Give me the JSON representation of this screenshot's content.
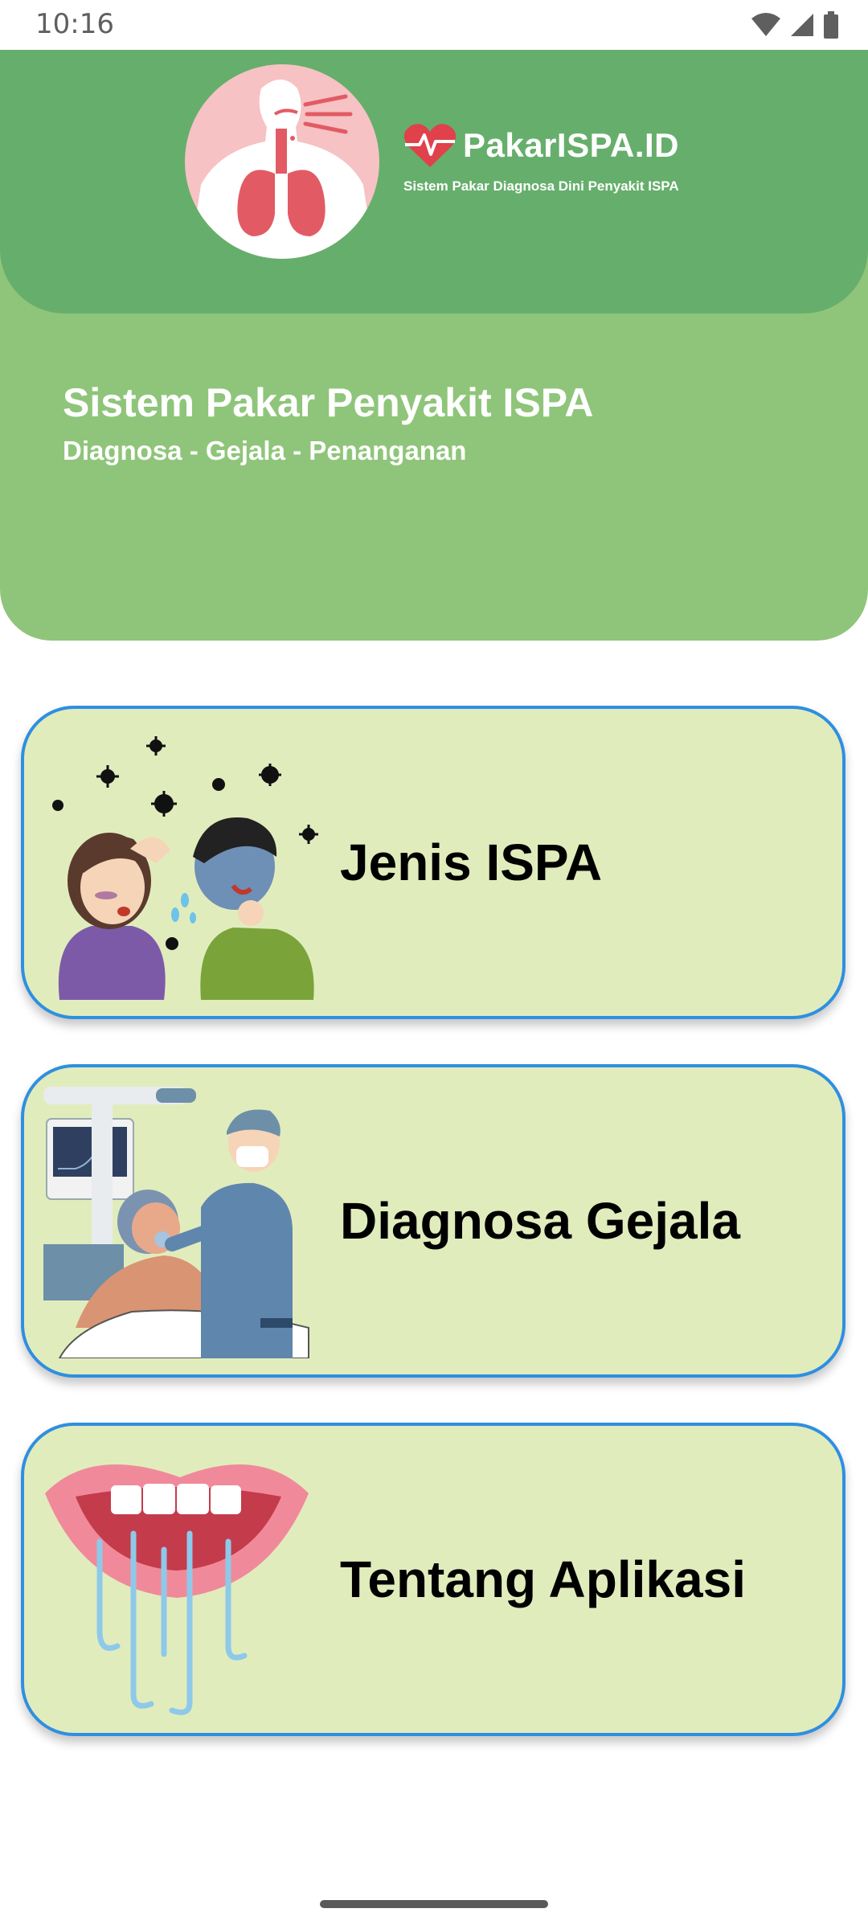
{
  "status_bar": {
    "time": "10:16"
  },
  "header": {
    "brand_name": "PakarISPA.ID",
    "brand_tagline": "Sistem Pakar Diagnosa Dini Penyakit ISPA",
    "title": "Sistem Pakar Penyakit ISPA",
    "subtitle": "Diagnosa - Gejala - Penanganan"
  },
  "menu": [
    {
      "label": "Jenis ISPA",
      "icon": "sick-people-illustration"
    },
    {
      "label": "Diagnosa Gejala",
      "icon": "doctor-patient-illustration"
    },
    {
      "label": "Tentang Aplikasi",
      "icon": "mouth-breath-illustration"
    }
  ],
  "colors": {
    "header_light": "#8fc57a",
    "header_dark": "#66ae6c",
    "card_bg": "#e1ecbd",
    "card_border": "#2f8fe0",
    "brand_heart": "#e0414b"
  }
}
